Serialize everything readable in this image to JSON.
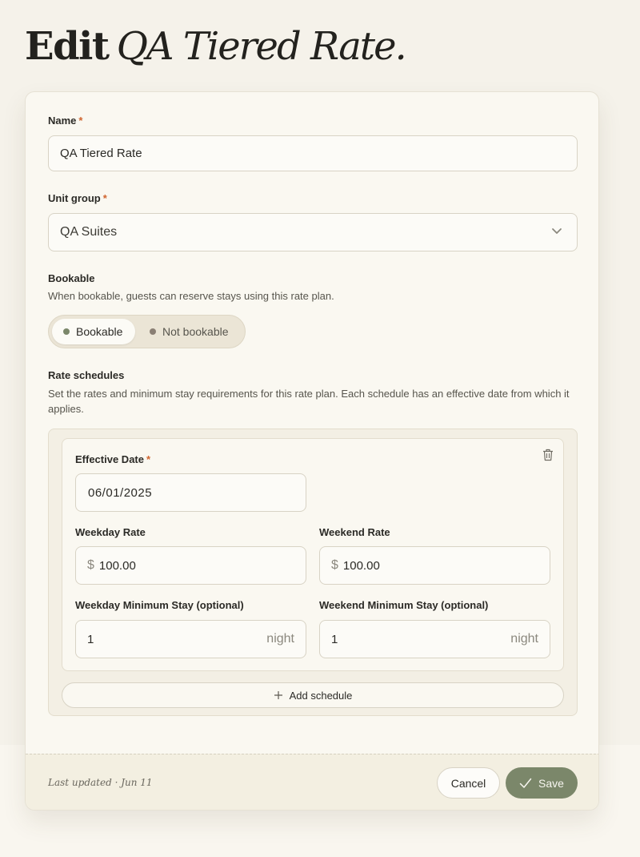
{
  "page": {
    "title_prefix": "Edit",
    "title_name": "QA Tiered Rate."
  },
  "form": {
    "name": {
      "label": "Name",
      "required": "*",
      "value": "QA Tiered Rate"
    },
    "unit_group": {
      "label": "Unit group",
      "required": "*",
      "value": "QA Suites"
    },
    "bookable": {
      "label": "Bookable",
      "help": "When bookable, guests can reserve stays using this rate plan.",
      "options": [
        "Bookable",
        "Not bookable"
      ],
      "selected": "Bookable"
    },
    "rate_schedules": {
      "label": "Rate schedules",
      "help": "Set the rates and minimum stay requirements for this rate plan. Each schedule has an effective date from which it applies.",
      "schedules": [
        {
          "effective_date": {
            "label": "Effective Date",
            "required": "*",
            "value": "06/01/2025"
          },
          "weekday_rate": {
            "label": "Weekday Rate",
            "prefix": "$",
            "value": "100.00"
          },
          "weekend_rate": {
            "label": "Weekend Rate",
            "prefix": "$",
            "value": "100.00"
          },
          "weekday_min_stay": {
            "label": "Weekday Minimum Stay (optional)",
            "value": "1",
            "suffix": "night"
          },
          "weekend_min_stay": {
            "label": "Weekend Minimum Stay (optional)",
            "value": "1",
            "suffix": "night"
          }
        }
      ],
      "add_label": "Add schedule"
    }
  },
  "footer": {
    "last_updated": "Last updated · Jun 11",
    "cancel_label": "Cancel",
    "save_label": "Save"
  },
  "colors": {
    "accent": "#7b876a",
    "required": "#d0652f",
    "background": "#f5f2ea"
  }
}
